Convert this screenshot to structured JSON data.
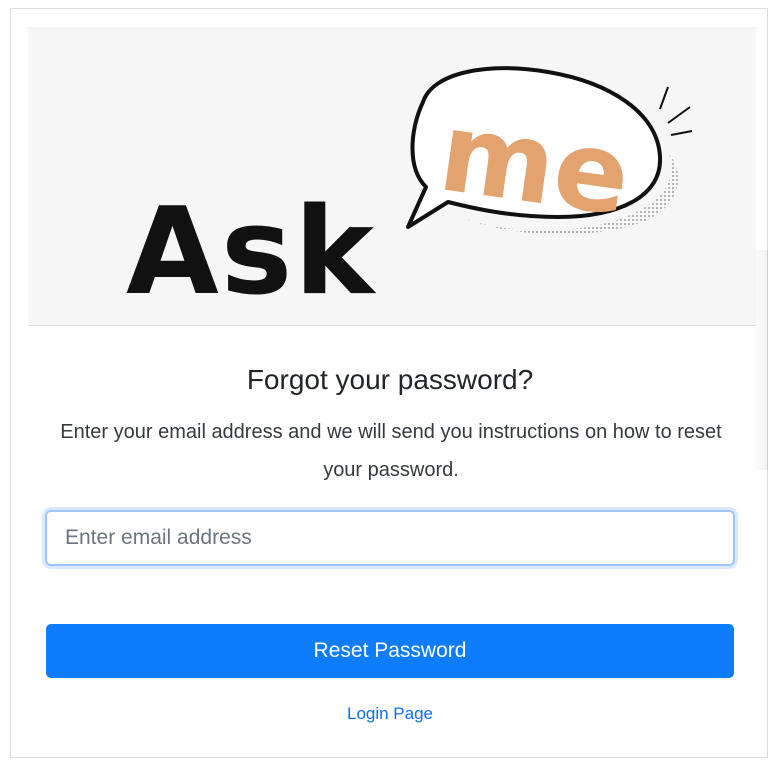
{
  "logo": {
    "word_ask": "Ask",
    "word_me": "me",
    "accent_color": "#e2a36e"
  },
  "heading": "Forgot your password?",
  "description": "Enter your email address and we will send you instructions on how to reset your password.",
  "email_input": {
    "placeholder": "Enter email address",
    "value": ""
  },
  "reset_button": {
    "label": "Reset Password",
    "color": "#0d7cfd"
  },
  "login_link": {
    "label": "Login Page"
  }
}
